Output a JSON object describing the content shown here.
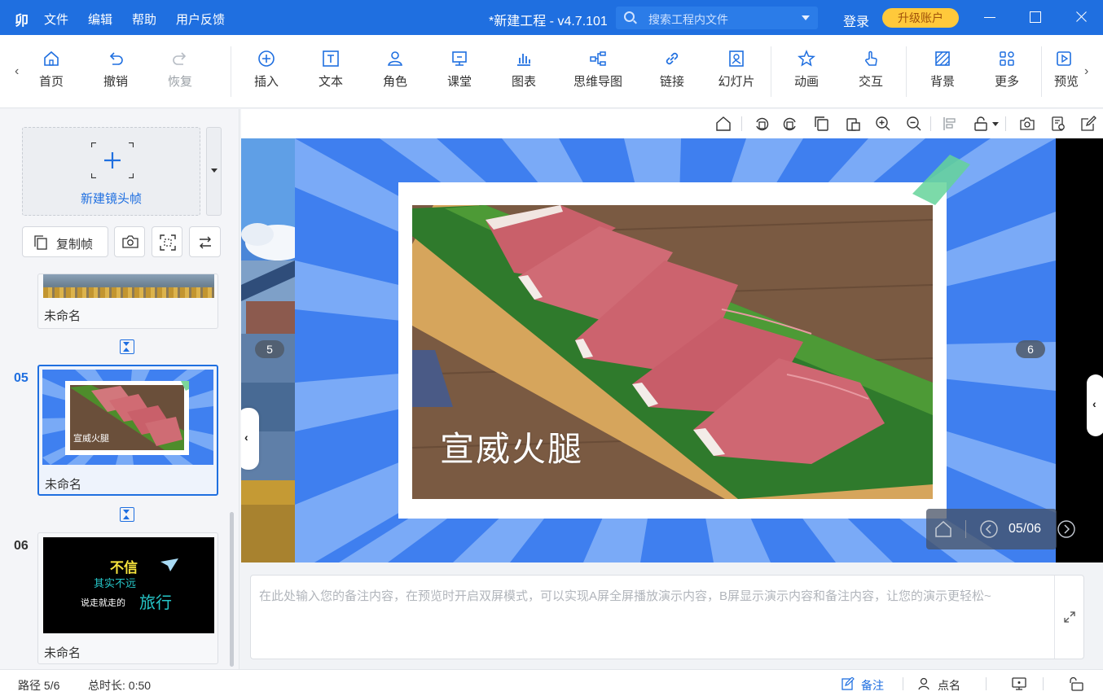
{
  "titlebar": {
    "logo": "卯",
    "menu": [
      "文件",
      "编辑",
      "帮助",
      "用户反馈"
    ],
    "title": "*新建工程 - v4.7.101",
    "search_placeholder": "搜索工程内文件",
    "login": "登录",
    "upgrade": "升级账户"
  },
  "toolbar": {
    "items": [
      {
        "label": "首页",
        "icon": "home-icon"
      },
      {
        "label": "撤销",
        "icon": "undo-icon"
      },
      {
        "label": "恢复",
        "icon": "redo-icon",
        "disabled": true
      },
      {
        "label": "插入",
        "icon": "plus-circle-icon"
      },
      {
        "label": "文本",
        "icon": "text-icon"
      },
      {
        "label": "角色",
        "icon": "character-icon"
      },
      {
        "label": "课堂",
        "icon": "classroom-icon"
      },
      {
        "label": "图表",
        "icon": "chart-icon"
      },
      {
        "label": "思维导图",
        "icon": "mindmap-icon"
      },
      {
        "label": "链接",
        "icon": "link-icon"
      },
      {
        "label": "幻灯片",
        "icon": "slide-icon"
      },
      {
        "label": "动画",
        "icon": "animation-star-icon"
      },
      {
        "label": "交互",
        "icon": "interaction-hand-icon"
      },
      {
        "label": "背景",
        "icon": "background-icon"
      },
      {
        "label": "更多",
        "icon": "more-grid-icon"
      },
      {
        "label": "预览",
        "icon": "preview-icon"
      }
    ]
  },
  "leftpanel": {
    "new_frame_label": "新建镜头帧",
    "copy_frame_label": "复制帧",
    "frames": [
      {
        "number": "",
        "name": "未命名"
      },
      {
        "number": "05",
        "name": "未命名",
        "thumb_text": "宣威火腿"
      },
      {
        "number": "06",
        "name": "未命名",
        "thumb_text": [
          "不信",
          "其实不远",
          "说走就走的",
          "旅行"
        ]
      }
    ]
  },
  "stage": {
    "slide_text": "宣威火腿",
    "badge_left": "5",
    "badge_right": "6",
    "page_indicator": "05/06"
  },
  "notes": {
    "placeholder": "在此处输入您的备注内容，在预览时开启双屏模式，可以实现A屏全屏播放演示内容，B屏显示演示内容和备注内容，让您的演示更轻松~"
  },
  "statusbar": {
    "path": "路径 5/6",
    "duration": "总时长: 0:50",
    "notes_label": "备注",
    "rollcall_label": "点名"
  },
  "colors": {
    "accent": "#1f6fe0",
    "upgrade_bg": "#ffc93b",
    "slide_bg": "#4d8bf0"
  }
}
